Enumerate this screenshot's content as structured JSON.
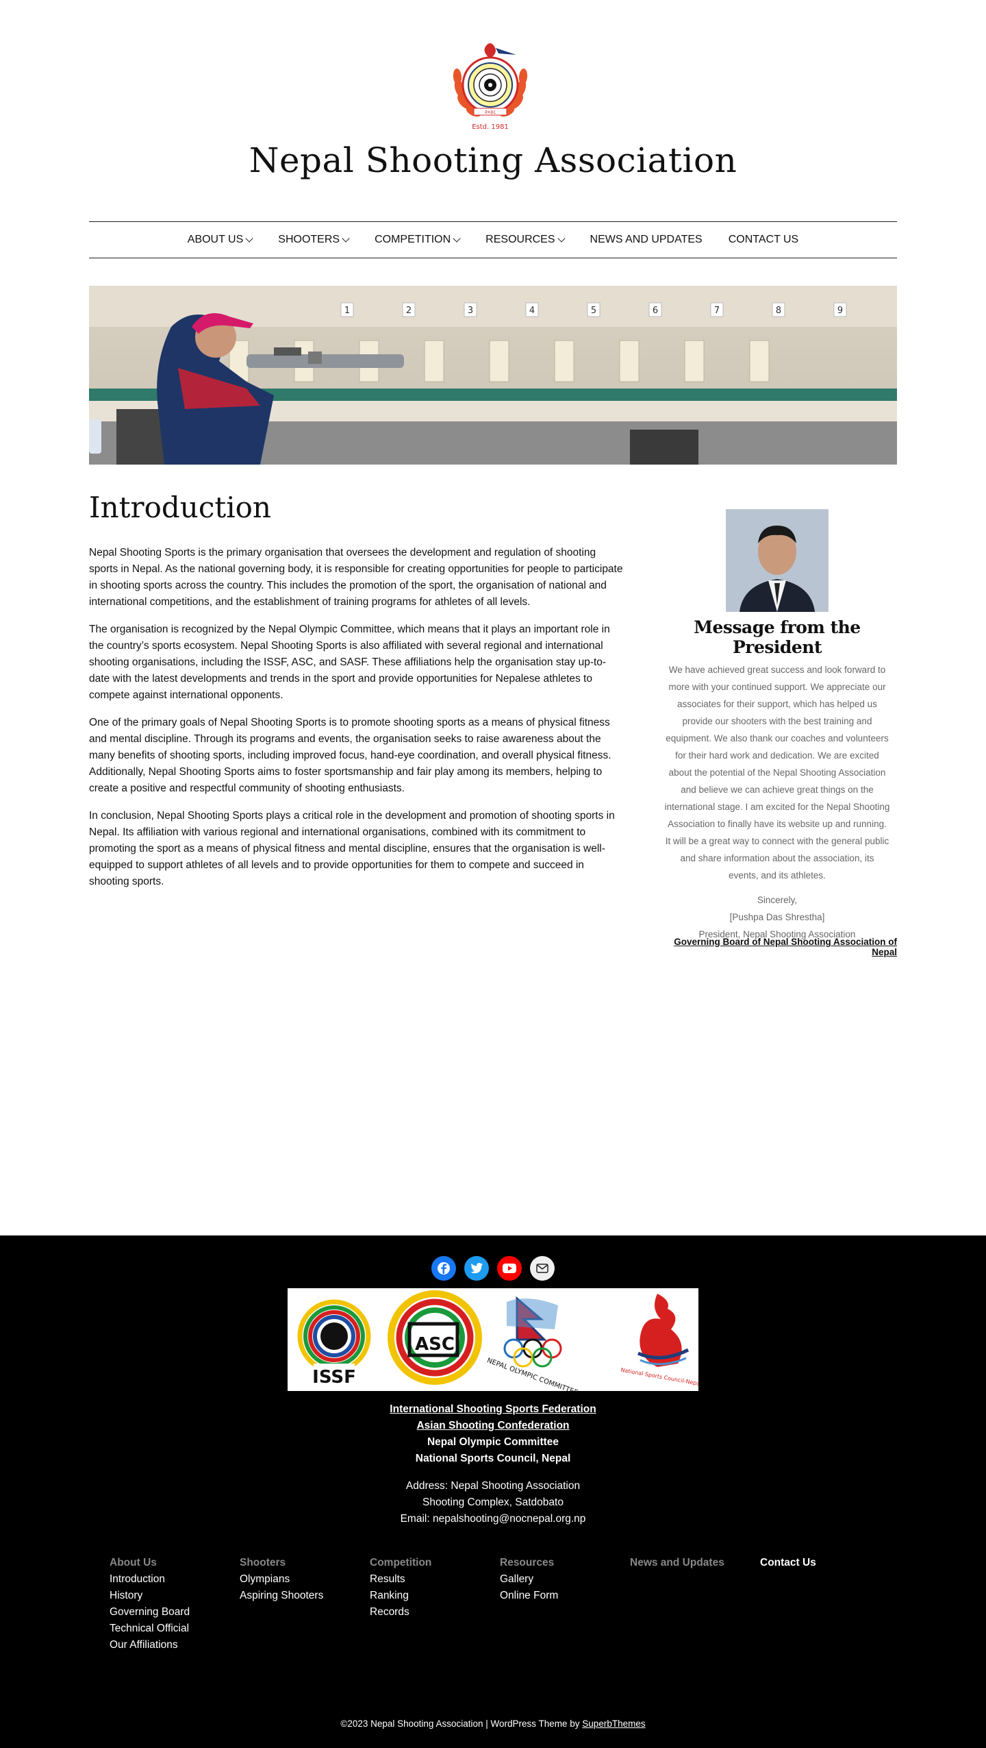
{
  "site": {
    "title": "Nepal Shooting Association",
    "logo_estd": "Estd. 1981"
  },
  "nav": {
    "items": [
      {
        "label": "ABOUT US",
        "has_dropdown": true
      },
      {
        "label": "SHOOTERS",
        "has_dropdown": true
      },
      {
        "label": "COMPETITION",
        "has_dropdown": true
      },
      {
        "label": "RESOURCES",
        "has_dropdown": true
      },
      {
        "label": "NEWS AND UPDATES",
        "has_dropdown": false
      },
      {
        "label": "CONTACT US",
        "has_dropdown": false
      }
    ]
  },
  "hero": {
    "lane_numbers": [
      "1",
      "2",
      "3",
      "4",
      "5",
      "6",
      "7",
      "8",
      "9"
    ]
  },
  "main": {
    "title": "Introduction",
    "paragraphs": [
      "Nepal Shooting Sports is the primary organisation that oversees the development and regulation of shooting sports in Nepal. As the national governing body, it is responsible for creating opportunities for people to participate in shooting sports across the country. This includes the promotion of the sport, the organisation of national and international competitions, and the establishment of training programs for athletes of all levels.",
      "The organisation is recognized by the Nepal Olympic Committee, which means that it plays an important role in the country’s sports ecosystem. Nepal Shooting Sports is also affiliated with several regional and international shooting organisations, including the ISSF, ASC, and SASF. These affiliations help the organisation stay up-to-date with the latest developments and trends in the sport and provide opportunities for Nepalese athletes to compete against international opponents.",
      "One of the primary goals of Nepal Shooting Sports is to promote shooting sports as a means of physical fitness and mental discipline. Through its programs and events, the organisation seeks to raise awareness about the many benefits of shooting sports, including improved focus, hand-eye coordination, and overall physical fitness. Additionally, Nepal Shooting Sports aims to foster sportsmanship and fair play among its members, helping to create a positive and respectful community of shooting enthusiasts.",
      "In conclusion, Nepal Shooting Sports plays a critical role in the development and promotion of shooting sports in Nepal. Its affiliation with various regional and international organisations, combined with its commitment to promoting the sport as a means of physical fitness and mental discipline, ensures that the organisation is well-equipped to support athletes of all levels and to provide opportunities for them to compete and succeed in shooting sports."
    ]
  },
  "sidebar": {
    "title": "Message from the President",
    "message": "We have achieved great success and look forward to more with your continued support. We appreciate our associates for their support, which has helped us provide our shooters with the best training and equipment. We also thank our coaches and volunteers for their hard work and dedication. We are excited about the potential of the Nepal Shooting Association and believe we can achieve great things on the international stage. I am excited for the Nepal Shooting Association to finally have its website up and running. It will be a great way to connect with the general public and share information about the association, its events, and its athletes.",
    "sign_off": "Sincerely,",
    "name": "[Pushpa Das Shrestha]",
    "role": "President, Nepal Shooting Association",
    "governing_link": "Governing Board of Nepal Shooting Association of Nepal"
  },
  "footer": {
    "social": [
      "facebook-icon",
      "twitter-icon",
      "youtube-icon",
      "mail-icon"
    ],
    "partner_logo_text": {
      "issf": "ISSF",
      "asc": "ASC",
      "noc": "NEPAL OLYMPIC COMMITTEE",
      "nsc": "National Sports Council-Nepal"
    },
    "links": [
      {
        "label": "International Shooting Sports Federation",
        "underline": true
      },
      {
        "label": "Asian Shooting Confederation",
        "underline": true
      },
      {
        "label": "Nepal Olympic Committee",
        "underline": false
      },
      {
        "label": "National Sports Council, Nepal",
        "underline": false
      }
    ],
    "address": [
      "Address: Nepal Shooting Association",
      "Shooting Complex, Satdobato",
      "Email: nepalshooting@nocnepal.org.np"
    ],
    "menu": [
      {
        "heading": "About Us",
        "items": [
          "Introduction",
          "History",
          "Governing Board",
          "Technical Official",
          "Our Affiliations"
        ]
      },
      {
        "heading": "Shooters",
        "items": [
          "Olympians",
          "Aspiring Shooters"
        ]
      },
      {
        "heading": "Competition",
        "items": [
          "Results",
          "Ranking",
          "Records"
        ]
      },
      {
        "heading": "Resources",
        "items": [
          "Gallery",
          "Online Form"
        ]
      },
      {
        "heading": "News and Updates",
        "items": []
      },
      {
        "heading": "Contact Us",
        "items": []
      }
    ],
    "copyright_prefix": "©2023 Nepal Shooting Association | WordPress Theme by ",
    "copyright_link": "SuperbThemes"
  },
  "colors": {
    "footer_bg": "#000000",
    "facebook": "#1877f2",
    "twitter": "#1d9bf0",
    "youtube": "#ff0000"
  }
}
